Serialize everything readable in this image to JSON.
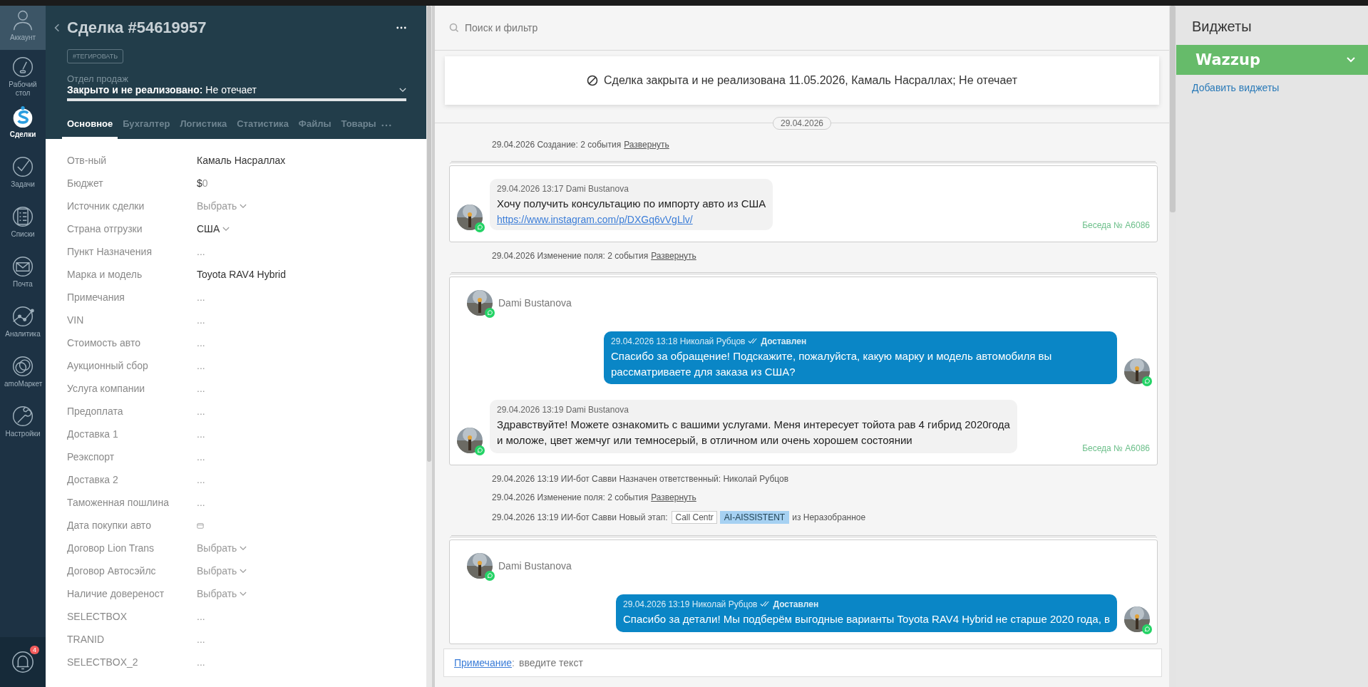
{
  "nav": {
    "items": [
      {
        "label": "Аккаунт",
        "kind": "account",
        "selected": false
      },
      {
        "label": "Рабочий стол",
        "kind": "dashboard",
        "selected": false
      },
      {
        "label": "Сделки",
        "kind": "deals",
        "selected": true
      },
      {
        "label": "Задачи",
        "kind": "tasks",
        "selected": false
      },
      {
        "label": "Списки",
        "kind": "lists",
        "selected": false
      },
      {
        "label": "Почта",
        "kind": "mail",
        "selected": false
      },
      {
        "label": "Аналитика",
        "kind": "analytics",
        "selected": false
      },
      {
        "label": "amoМаркет",
        "kind": "market",
        "selected": false
      },
      {
        "label": "Настройки",
        "kind": "settings",
        "selected": false
      }
    ],
    "notifications": {
      "badge": "4"
    }
  },
  "deal": {
    "title": "Сделка #54619957",
    "tag": "#ТЕГИРОВАТЬ",
    "pipeline": "Отдел продаж",
    "status": "Закрыто и не реализовано:",
    "reason": "Не отечает",
    "tabs": [
      {
        "label": "Основное",
        "selected": true
      },
      {
        "label": "Бухгалтер",
        "selected": false
      },
      {
        "label": "Логистика",
        "selected": false
      },
      {
        "label": "Статистика",
        "selected": false
      },
      {
        "label": "Файлы",
        "selected": false
      },
      {
        "label": "Товары",
        "selected": false
      }
    ],
    "fields": [
      {
        "label": "Отв-ный",
        "kind": "text",
        "value": "Камаль Насраллах"
      },
      {
        "label": "Бюджет",
        "kind": "money",
        "currency": "$",
        "value": "0"
      },
      {
        "label": "Источник сделки",
        "kind": "select",
        "value": "Выбрать"
      },
      {
        "label": "Страна отгрузки",
        "kind": "select",
        "value": "США",
        "filled": true
      },
      {
        "label": "Пункт Назначения",
        "kind": "empty",
        "value": "..."
      },
      {
        "label": "Марка и модель",
        "kind": "text",
        "value": "Toyota RAV4 Hybrid"
      },
      {
        "label": "Примечания",
        "kind": "empty",
        "value": "..."
      },
      {
        "label": "VIN",
        "kind": "empty",
        "value": "..."
      },
      {
        "label": "Стоимость авто",
        "kind": "empty",
        "value": "..."
      },
      {
        "label": "Аукционный сбор",
        "kind": "empty",
        "value": "..."
      },
      {
        "label": "Услуга компании",
        "kind": "empty",
        "value": "..."
      },
      {
        "label": "Предоплата",
        "kind": "empty",
        "value": "..."
      },
      {
        "label": "Доставка 1",
        "kind": "empty",
        "value": "..."
      },
      {
        "label": "Реэкспорт",
        "kind": "empty",
        "value": "..."
      },
      {
        "label": "Доставка 2",
        "kind": "empty",
        "value": "..."
      },
      {
        "label": "Таможенная пошлина",
        "kind": "empty",
        "value": "..."
      },
      {
        "label": "Дата покупки авто",
        "kind": "date"
      },
      {
        "label": "Договор Lion Trans",
        "kind": "select",
        "value": "Выбрать"
      },
      {
        "label": "Договор Автосэйлс",
        "kind": "select",
        "value": "Выбрать"
      },
      {
        "label": "Наличие довереност",
        "kind": "select",
        "value": "Выбрать"
      },
      {
        "label": "SELECTBOX",
        "kind": "empty",
        "value": "..."
      },
      {
        "label": "TRANID",
        "kind": "empty",
        "value": "..."
      },
      {
        "label": "SELECTBOX_2",
        "kind": "empty",
        "value": "..."
      }
    ]
  },
  "feed": {
    "search": {
      "placeholder": "Поиск и фильтр"
    },
    "banner": "Сделка закрыта и не реализована 11.05.2026, Камаль Насраллах; Не отечает",
    "date": "29.04.2026",
    "items": [
      {
        "kind": "event",
        "text": "29.04.2026 Создание: 2 события",
        "link": "Развернуть"
      },
      {
        "kind": "chat",
        "conversation": "Беседа № А6086",
        "messages": [
          {
            "kind": "incoming",
            "meta": "29.04.2026 13:17 Dami Bustanova",
            "text": "Хочу получить консультацию по импорту авто из США",
            "link": "https://www.instagram.com/p/DXGq6vVgLlv/"
          }
        ]
      },
      {
        "kind": "event",
        "text": "29.04.2026 Изменение поля: 2 события",
        "link": "Развернуть"
      },
      {
        "kind": "chat",
        "contact": "Dami Bustanova",
        "conversation": "Беседа № А6086",
        "messages": [
          {
            "kind": "outgoing",
            "meta": "29.04.2026 13:18 Николай Рубцов",
            "status": "Доставлен",
            "text": "Спасибо за обращение! Подскажите, пожалуйста, какую марку и модель автомобиля вы рассматриваете для заказа из США?"
          },
          {
            "kind": "incoming",
            "meta": "29.04.2026 13:19 Dami Bustanova",
            "text": "Здравствуйте! Можете ознакомить с вашими услугами. Меня интересует тойота рав 4 гибрид 2020года и моложе, цвет жемчуг или темносерый, в отличном или очень хорошем состоянии"
          }
        ]
      },
      {
        "kind": "event",
        "text": "29.04.2026 13:19 ИИ-бот Савви Назначен ответственный: Николай Рубцов"
      },
      {
        "kind": "event",
        "text": "29.04.2026 Изменение поля: 2 события",
        "link": "Развернуть"
      },
      {
        "kind": "stage",
        "text": "29.04.2026 13:19 ИИ-бот Савви Новый этап:",
        "from_stage": "Call Centr",
        "to_stage": "AI-AISSISTENT",
        "after": "из Неразобранное"
      },
      {
        "kind": "chat",
        "contact": "Dami Bustanova",
        "messages": [
          {
            "kind": "outgoing",
            "meta": "29.04.2026 13:19 Николай Рубцов",
            "status": "Доставлен",
            "text": "Спасибо за детали! Мы подберём выгодные варианты Toyota RAV4 Hybrid не старше 2020 года, в"
          }
        ]
      }
    ],
    "note": {
      "link": "Примечание",
      "separator": ":",
      "placeholder": "введите текст"
    }
  },
  "widgets": {
    "title": "Виджеты",
    "items": [
      {
        "name": "Wazzup"
      }
    ],
    "add_link": "Добавить виджеты"
  }
}
